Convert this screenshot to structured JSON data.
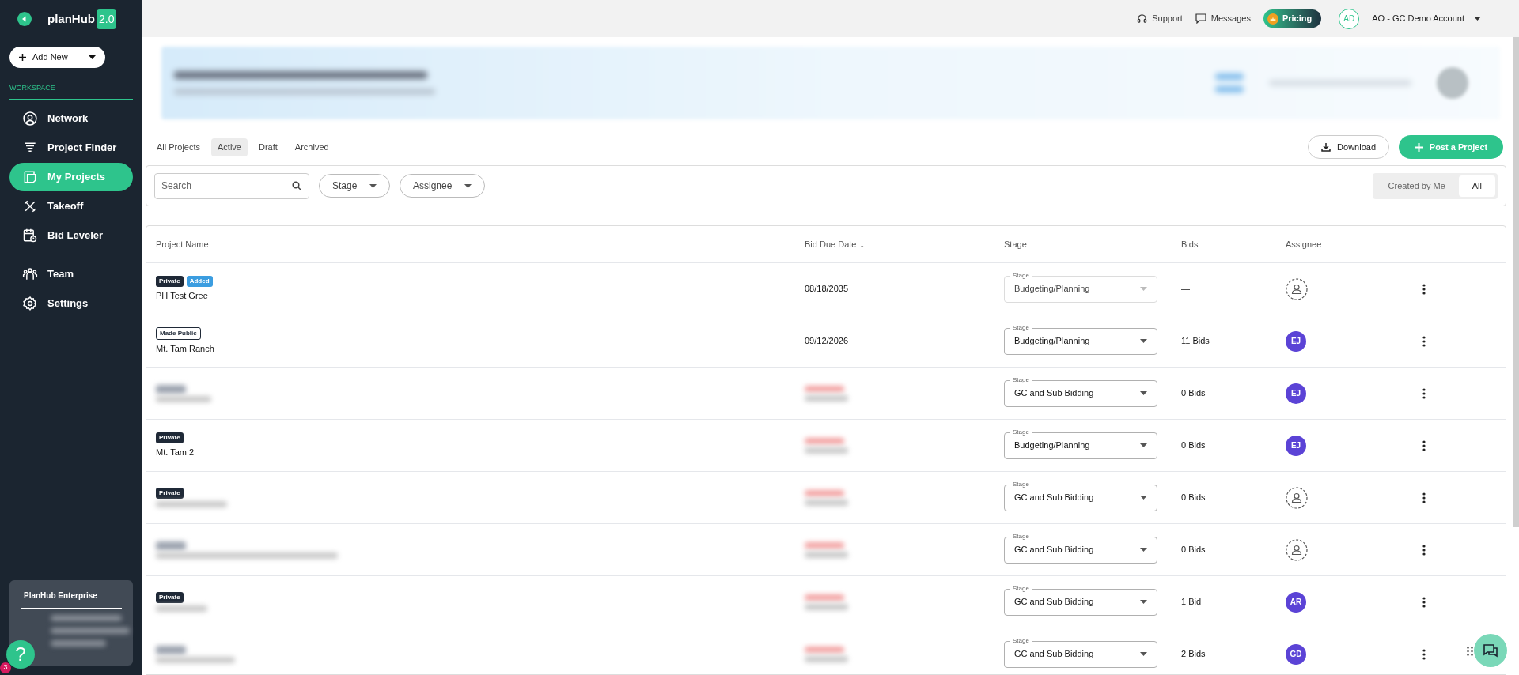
{
  "sidebar": {
    "logo": "planHub",
    "version": "2.0",
    "add_new": "Add New",
    "section": "WORKSPACE",
    "items": [
      {
        "label": "Network",
        "selected": false
      },
      {
        "label": "Project Finder",
        "selected": false
      },
      {
        "label": "My Projects",
        "selected": true
      },
      {
        "label": "Takeoff",
        "selected": false
      },
      {
        "label": "Bid Leveler",
        "selected": false
      }
    ],
    "items_2": [
      {
        "label": "Team",
        "selected": false
      },
      {
        "label": "Settings",
        "selected": false
      }
    ],
    "enterprise": {
      "title": "PlanHub Enterprise"
    },
    "help": {
      "label": "?",
      "badge": "3"
    }
  },
  "topbar": {
    "support": "Support",
    "messages": "Messages",
    "pricing": "Pricing",
    "avatar": "AD",
    "account": "AO - GC Demo Account"
  },
  "tabs": [
    {
      "label": "All Projects",
      "selected": false
    },
    {
      "label": "Active",
      "selected": true
    },
    {
      "label": "Draft",
      "selected": false
    },
    {
      "label": "Archived",
      "selected": false
    }
  ],
  "actions": {
    "download": "Download",
    "post": "Post a Project"
  },
  "filters": {
    "search": {
      "placeholder": "Search"
    },
    "stage": "Stage",
    "assignee": "Assignee",
    "scope": [
      {
        "label": "Created by Me",
        "selected": false
      },
      {
        "label": "All",
        "selected": true
      }
    ]
  },
  "table": {
    "columns": [
      "Project Name",
      "Bid Due Date",
      "Stage",
      "Bids",
      "Assignee"
    ],
    "sort_icon": "↓",
    "rows": [
      {
        "badges": [
          {
            "label": "Private",
            "kind": "private"
          },
          {
            "label": "Added",
            "kind": "added"
          }
        ],
        "name": "PH Test Gree",
        "date": "08/18/2035",
        "stage_label": "Stage",
        "stage": "Budgeting/Planning",
        "stage_disabled": true,
        "bids": "—",
        "assignee": {
          "kind": "unassigned"
        }
      },
      {
        "badges": [
          {
            "label": "Made Public",
            "kind": "public"
          }
        ],
        "name": "Mt. Tam Ranch",
        "date": "09/12/2026",
        "stage_label": "Stage",
        "stage": "Budgeting/Planning",
        "stage_disabled": false,
        "bids": "11 Bids",
        "assignee": {
          "kind": "initials",
          "initials": "EJ"
        }
      },
      {
        "stage_label": "Stage",
        "stage": "GC and Sub Bidding",
        "stage_disabled": false,
        "bids": "0 Bids",
        "assignee": {
          "kind": "initials",
          "initials": "EJ"
        }
      },
      {
        "badges": [
          {
            "label": "Private",
            "kind": "private"
          }
        ],
        "name": "Mt. Tam 2",
        "stage_label": "Stage",
        "stage": "Budgeting/Planning",
        "stage_disabled": false,
        "bids": "0 Bids",
        "assignee": {
          "kind": "initials",
          "initials": "EJ"
        }
      },
      {
        "badges": [
          {
            "label": "Private",
            "kind": "private"
          }
        ],
        "stage_label": "Stage",
        "stage": "GC and Sub Bidding",
        "stage_disabled": false,
        "bids": "0 Bids",
        "assignee": {
          "kind": "unassigned"
        }
      },
      {
        "stage_label": "Stage",
        "stage": "GC and Sub Bidding",
        "stage_disabled": false,
        "bids": "0 Bids",
        "assignee": {
          "kind": "unassigned"
        }
      },
      {
        "badges": [
          {
            "label": "Private",
            "kind": "private"
          }
        ],
        "stage_label": "Stage",
        "stage": "GC and Sub Bidding",
        "stage_disabled": false,
        "bids": "1 Bid",
        "assignee": {
          "kind": "initials",
          "initials": "AR"
        }
      },
      {
        "stage_label": "Stage",
        "stage": "GC and Sub Bidding",
        "stage_disabled": false,
        "bids": "2 Bids",
        "assignee": {
          "kind": "initials",
          "initials": "GD"
        }
      }
    ]
  }
}
